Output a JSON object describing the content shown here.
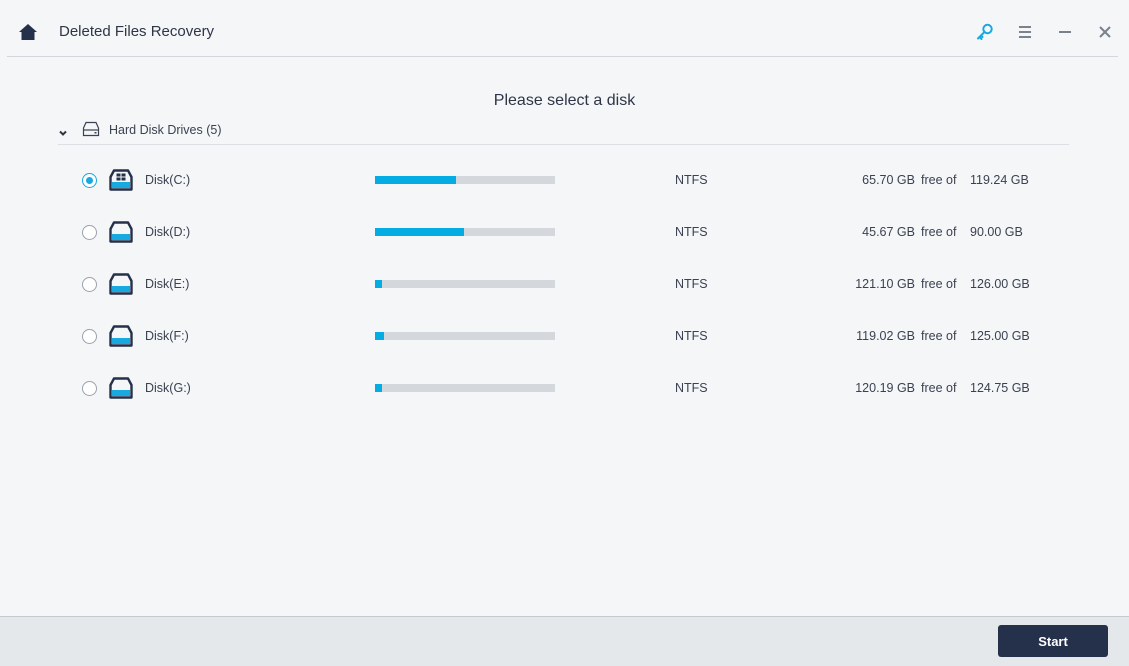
{
  "window": {
    "title": "Deleted Files Recovery",
    "icons": {
      "home": "home-icon",
      "key": "key-icon",
      "menu": "hamburger-menu-icon",
      "minimize": "minimize-icon",
      "close": "close-icon"
    },
    "accent_color": "#18a9e0"
  },
  "main": {
    "heading": "Please select a disk",
    "group": {
      "label": "Hard Disk Drives (5)",
      "expanded": true,
      "icon": "hard-disk-icon"
    },
    "free_of_label": "free of",
    "disks": [
      {
        "name": "Disk(C:)",
        "filesystem": "NTFS",
        "free": "65.70 GB",
        "total": "119.24 GB",
        "used_fraction": 0.449,
        "selected": true,
        "icon": "system-disk-icon"
      },
      {
        "name": "Disk(D:)",
        "filesystem": "NTFS",
        "free": "45.67 GB",
        "total": "90.00 GB",
        "used_fraction": 0.493,
        "selected": false,
        "icon": "disk-icon"
      },
      {
        "name": "Disk(E:)",
        "filesystem": "NTFS",
        "free": "121.10 GB",
        "total": "126.00 GB",
        "used_fraction": 0.039,
        "selected": false,
        "icon": "disk-icon"
      },
      {
        "name": "Disk(F:)",
        "filesystem": "NTFS",
        "free": "119.02 GB",
        "total": "125.00 GB",
        "used_fraction": 0.048,
        "selected": false,
        "icon": "disk-icon"
      },
      {
        "name": "Disk(G:)",
        "filesystem": "NTFS",
        "free": "120.19 GB",
        "total": "124.75 GB",
        "used_fraction": 0.037,
        "selected": false,
        "icon": "disk-icon"
      }
    ]
  },
  "footer": {
    "start_label": "Start"
  }
}
